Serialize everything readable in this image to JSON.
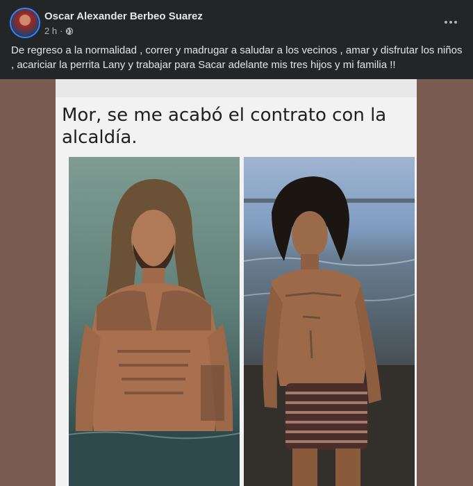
{
  "post": {
    "author_name": "Oscar Alexander Berbeo Suarez",
    "timestamp": "2 h",
    "separator": "·",
    "privacy_icon": "globe-icon",
    "more_icon": "more-horizontal-icon",
    "text": "De regreso a la normalidad , correr y madrugar a saludar a los vecinos  , amar y disfrutar los niños , acariciar la perrita Lany y trabajar para Sacar  adelante mis tres hijos y mi familia !!"
  },
  "media": {
    "caption": "Mor, se me acabó el contrato con la alcaldía."
  },
  "colors": {
    "card_background": "#242526",
    "page_background": "#18191a",
    "primary_text": "#e4e6eb",
    "secondary_text": "#b0b3b8",
    "media_background": "#7a5b52"
  }
}
